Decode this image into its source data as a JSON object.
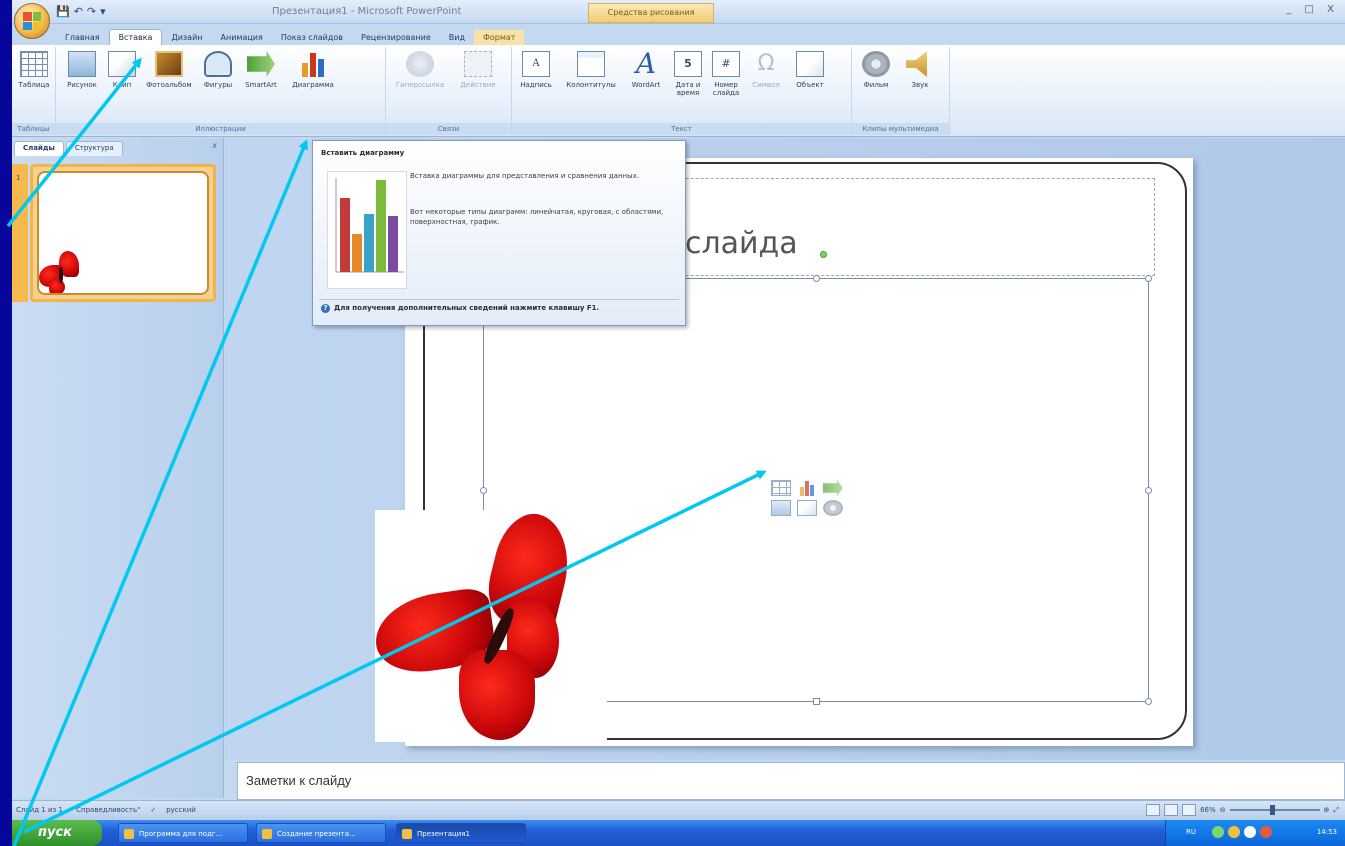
{
  "window": {
    "title": "Презентация1 - Microsoft PowerPoint",
    "context_tool": "Средства рисования",
    "controls": "_ □ X"
  },
  "tabs": [
    {
      "label": "Главная"
    },
    {
      "label": "Вставка"
    },
    {
      "label": "Дизайн"
    },
    {
      "label": "Анимация"
    },
    {
      "label": "Показ слайдов"
    },
    {
      "label": "Рецензирование"
    },
    {
      "label": "Вид"
    },
    {
      "label": "Формат"
    }
  ],
  "ribbon": {
    "groups": {
      "tables": "Таблицы",
      "illustrations": "Иллюстрации",
      "links": "Связи",
      "text": "Текст",
      "media": "Клипы мультимедиа"
    },
    "buttons": {
      "table": "Таблица",
      "picture": "Рисунок",
      "clip": "Клип",
      "album": "Фотоальбом",
      "shapes": "Фигуры",
      "smartart": "SmartArt",
      "chart": "Диаграмма",
      "hyperlink": "Гиперссылка",
      "action": "Действие",
      "textbox": "Надпись",
      "header": "Колонтитулы",
      "wordart": "WordArt",
      "datetime": "Дата и время",
      "slidenum": "Номер слайда",
      "symbol": "Символ",
      "object": "Объект",
      "movie": "Фильм",
      "sound": "Звук"
    }
  },
  "left_panel": {
    "tab_slides": "Слайды",
    "tab_outline": "Структура",
    "close": "x",
    "slide_number": "1"
  },
  "slide": {
    "title": "слайда"
  },
  "tooltip": {
    "title": "Вставить диаграмму",
    "p1": "Вставка диаграммы для представления и сравнения данных.",
    "p2": "Вот некоторые типы диаграмм: линейчатая, круговая, с областями, поверхностная, график.",
    "help": "Для получения дополнительных сведений нажмите клавишу F1."
  },
  "notes": {
    "placeholder": "Заметки к слайду"
  },
  "status": {
    "slide_info": "Слайд 1 из 1",
    "theme": "\"Справедливость\"",
    "language": "русский",
    "zoom": "66%"
  },
  "taskbar": {
    "start": "пуск",
    "tasks": [
      {
        "label": "Программа для подг..."
      },
      {
        "label": "Создание презента..."
      },
      {
        "label": "Презентация1"
      }
    ],
    "lang": "RU",
    "clock": "14:53"
  },
  "colors": {
    "accent_arrow": "#00c8f0",
    "ribbon_hot": "#ffd46b",
    "slide_bg": "#ffffff"
  }
}
